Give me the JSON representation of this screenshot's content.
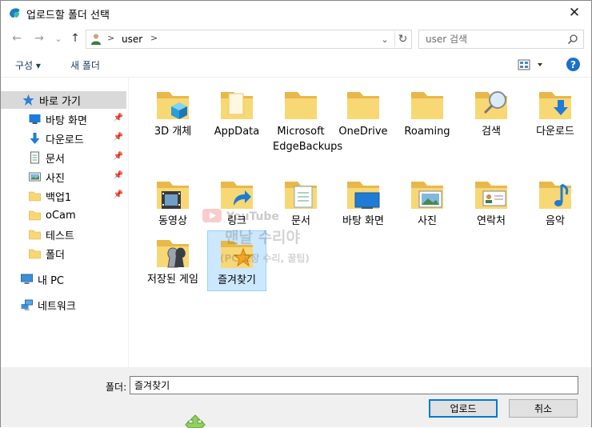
{
  "window": {
    "title": "업로드할 폴더 선택",
    "close_symbol": "✕"
  },
  "nav": {
    "back_symbol": "←",
    "forward_symbol": "→",
    "recent_symbol": "⌄",
    "up_symbol": "↑",
    "breadcrumb": {
      "separator": ">",
      "path": "user"
    },
    "dropdown_symbol": "⌄",
    "refresh_symbol": "↻"
  },
  "search": {
    "placeholder": "user 검색",
    "icon": "search-icon"
  },
  "toolbar": {
    "organize_label": "구성 ▾",
    "new_folder_label": "새 폴더",
    "help_label": "?"
  },
  "sidebar": {
    "quick_access": "바로 가기",
    "items": [
      {
        "label": "바탕 화면",
        "icon": "desktop-icon",
        "pinned": true
      },
      {
        "label": "다운로드",
        "icon": "download-icon",
        "pinned": true
      },
      {
        "label": "문서",
        "icon": "document-icon",
        "pinned": true
      },
      {
        "label": "사진",
        "icon": "pictures-icon",
        "pinned": true
      },
      {
        "label": "백업1",
        "icon": "folder-icon",
        "pinned": true
      },
      {
        "label": "oCam",
        "icon": "folder-icon",
        "pinned": false
      },
      {
        "label": "테스트",
        "icon": "folder-icon",
        "pinned": false
      },
      {
        "label": "폴더",
        "icon": "folder-icon",
        "pinned": false
      }
    ],
    "this_pc": "내 PC",
    "network": "네트워크",
    "pin_symbol": "📌"
  },
  "folders": [
    {
      "label": "3D 개체",
      "icon": "3d-objects-folder-icon"
    },
    {
      "label": "AppData",
      "icon": "appdata-folder-icon"
    },
    {
      "label": "Microsoft EdgeBackups",
      "icon": "folder-icon"
    },
    {
      "label": "OneDrive",
      "icon": "folder-icon"
    },
    {
      "label": "Roaming",
      "icon": "folder-icon"
    },
    {
      "label": "검색",
      "icon": "searches-folder-icon"
    },
    {
      "label": "다운로드",
      "icon": "downloads-folder-icon"
    },
    {
      "label": "동영상",
      "icon": "videos-folder-icon"
    },
    {
      "label": "링크",
      "icon": "links-folder-icon"
    },
    {
      "label": "문서",
      "icon": "documents-folder-icon"
    },
    {
      "label": "바탕 화면",
      "icon": "desktop-folder-icon"
    },
    {
      "label": "사진",
      "icon": "pictures-folder-icon"
    },
    {
      "label": "연락처",
      "icon": "contacts-folder-icon"
    },
    {
      "label": "음악",
      "icon": "music-folder-icon"
    },
    {
      "label": "저장된 게임",
      "icon": "saved-games-folder-icon"
    },
    {
      "label": "즐겨찾기",
      "icon": "favorites-folder-icon",
      "selected": true
    }
  ],
  "watermark": {
    "line1": "YouTube",
    "line2": "맨날 수리야",
    "line3": "(PC 고장 수리, 꿀팁)"
  },
  "footer": {
    "folder_label": "폴더:",
    "folder_value": "즐겨찾기",
    "upload_button": "업로드",
    "cancel_button": "취소"
  },
  "colors": {
    "folder": "#f8d775",
    "folder_dark": "#e8b84a",
    "accent": "#0078d7",
    "selection": "#cce8ff"
  }
}
